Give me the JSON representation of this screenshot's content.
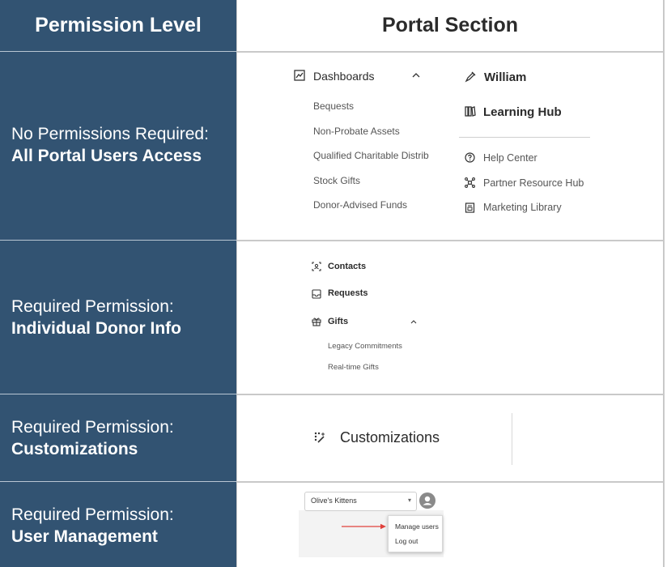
{
  "header": {
    "col1": "Permission Level",
    "col2": "Portal Section"
  },
  "rows": [
    {
      "permission_line1": "No Permissions Required:",
      "permission_line2": "All Portal Users Access",
      "dashboards": {
        "label": "Dashboards",
        "items": [
          "Bequests",
          "Non-Probate Assets",
          "Qualified Charitable Distrib",
          "Stock Gifts",
          "Donor-Advised Funds"
        ]
      },
      "william": "William",
      "learning_hub": "Learning Hub",
      "links": [
        "Help Center",
        "Partner Resource Hub",
        "Marketing Library"
      ]
    },
    {
      "permission_line1": "Required Permission:",
      "permission_line2": "Individual Donor Info",
      "contacts": "Contacts",
      "requests": "Requests",
      "gifts": {
        "label": "Gifts",
        "items": [
          "Legacy Commitments",
          "Real-time Gifts"
        ]
      }
    },
    {
      "permission_line1": "Required Permission:",
      "permission_line2": "Customizations",
      "customizations": "Customizations"
    },
    {
      "permission_line1": "Required Permission:",
      "permission_line2": "User Management",
      "org_select": "Olive's Kittens",
      "dropdown_items": [
        "Manage users",
        "Log out"
      ]
    }
  ],
  "icons": {
    "dashboards": "chart-icon",
    "william": "pen-icon",
    "learning_hub": "books-icon",
    "help": "question-icon",
    "partner": "network-icon",
    "marketing": "library-icon",
    "contacts": "contact-card-icon",
    "requests": "inbox-icon",
    "gifts": "gift-icon",
    "customizations": "sparkle-icon",
    "avatar": "user-avatar-icon"
  },
  "colors": {
    "left_panel": "#325372",
    "grid": "#c9c9c9",
    "arrow": "#e0413b"
  }
}
